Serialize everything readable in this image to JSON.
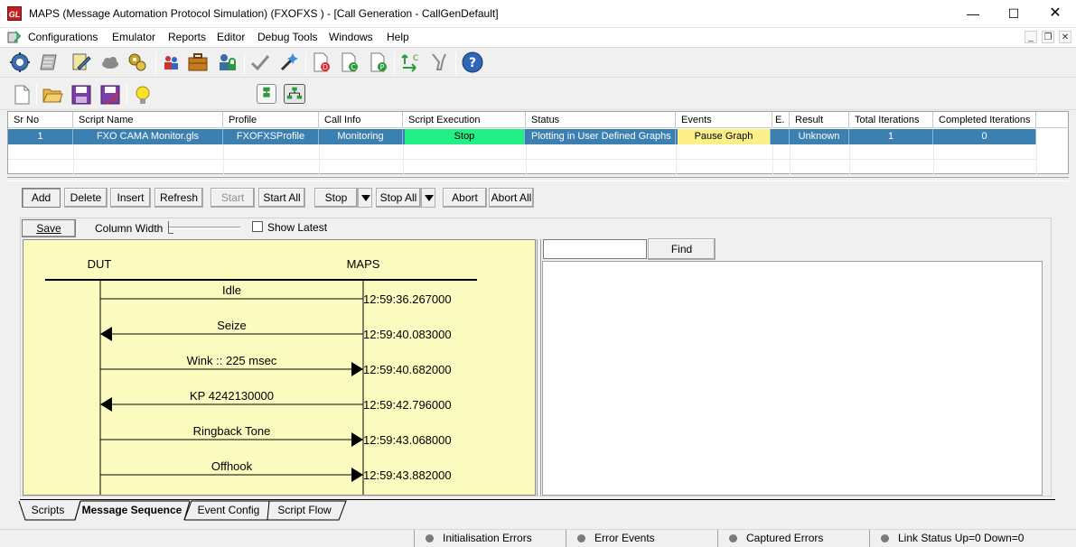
{
  "window": {
    "logo_text": "GL",
    "title": "MAPS (Message Automation Protocol Simulation)  (FXOFXS  ) - [Call Generation  - CallGenDefault]",
    "min_glyph": "—",
    "max_glyph": "☐",
    "close_glyph": "✕"
  },
  "menu": {
    "items": [
      "Configurations",
      "Emulator",
      "Reports",
      "Editor",
      "Debug Tools",
      "Windows",
      "Help"
    ],
    "mdi_min": "_",
    "mdi_restore": "❐",
    "mdi_close": "✕"
  },
  "toolbar1": {
    "icons": [
      "configuration-icon",
      "list-icon",
      "profile-editor-icon",
      "cloud-icon",
      "settings-gears-icon",
      "users-icon",
      "briefcase-icon",
      "user-lock-icon",
      "checkmark-icon",
      "wizard-icon",
      "document-d-icon",
      "document-c-icon",
      "document-p-icon",
      "exchange-icon",
      "tools-icon",
      "help-icon"
    ]
  },
  "toolbar2": {
    "icons": [
      "new-file-icon",
      "open-folder-icon",
      "save-icon",
      "save-as-icon",
      "lightbulb-icon",
      "vertical-layout-icon",
      "tree-layout-icon"
    ]
  },
  "grid": {
    "columns": [
      "Sr No",
      "Script Name",
      "Profile",
      "Call Info",
      "Script Execution",
      "Status",
      "Events",
      "E.",
      "Result",
      "Total Iterations",
      "Completed Iterations"
    ],
    "rows": [
      {
        "sr_no": "1",
        "script_name": "FXO CAMA Monitor.gls",
        "profile": "FXOFXSProfile",
        "call_info": "Monitoring",
        "script_execution": "Stop",
        "status": "Plotting in User Defined Graphs",
        "events": "Pause Graph",
        "e": "",
        "result": "Unknown",
        "total_iterations": "1",
        "completed_iterations": "0"
      }
    ],
    "colors": {
      "selected_row": "#3c7fb1",
      "execution_cell": "#23ef86",
      "events_cell": "#fdf08a"
    }
  },
  "actions": {
    "add": "Add",
    "delete": "Delete",
    "insert": "Insert",
    "refresh": "Refresh",
    "start": "Start",
    "start_all": "Start All",
    "stop": "Stop",
    "stop_all": "Stop All",
    "abort": "Abort",
    "abort_all": "Abort All"
  },
  "panel": {
    "save_label": "Save",
    "column_width_label": "Column Width",
    "show_latest_label": "Show Latest",
    "show_latest_checked": false,
    "find_label": "Find",
    "find_value": ""
  },
  "sequence": {
    "left_entity": "DUT",
    "right_entity": "MAPS",
    "background": "#fbfbc0",
    "messages": [
      {
        "label": "Idle",
        "direction": "none",
        "time": "12:59:36.267000"
      },
      {
        "label": "Seize",
        "direction": "left",
        "time": "12:59:40.083000"
      },
      {
        "label": "Wink :: 225 msec",
        "direction": "right",
        "time": "12:59:40.682000"
      },
      {
        "label": "KP 4242130000",
        "direction": "left",
        "time": "12:59:42.796000"
      },
      {
        "label": "Ringback Tone",
        "direction": "right",
        "time": "12:59:43.068000"
      },
      {
        "label": "Offhook",
        "direction": "right",
        "time": "12:59:43.882000"
      }
    ]
  },
  "tabs": [
    {
      "label": "Scripts",
      "active": false
    },
    {
      "label": "Message Sequence",
      "active": true
    },
    {
      "label": "Event Config",
      "active": false
    },
    {
      "label": "Script Flow",
      "active": false
    }
  ],
  "statusbar": {
    "init_errors": "Initialisation Errors",
    "error_events": "Error Events",
    "captured_errors": "Captured Errors",
    "link_status": "Link Status Up=0 Down=0"
  }
}
